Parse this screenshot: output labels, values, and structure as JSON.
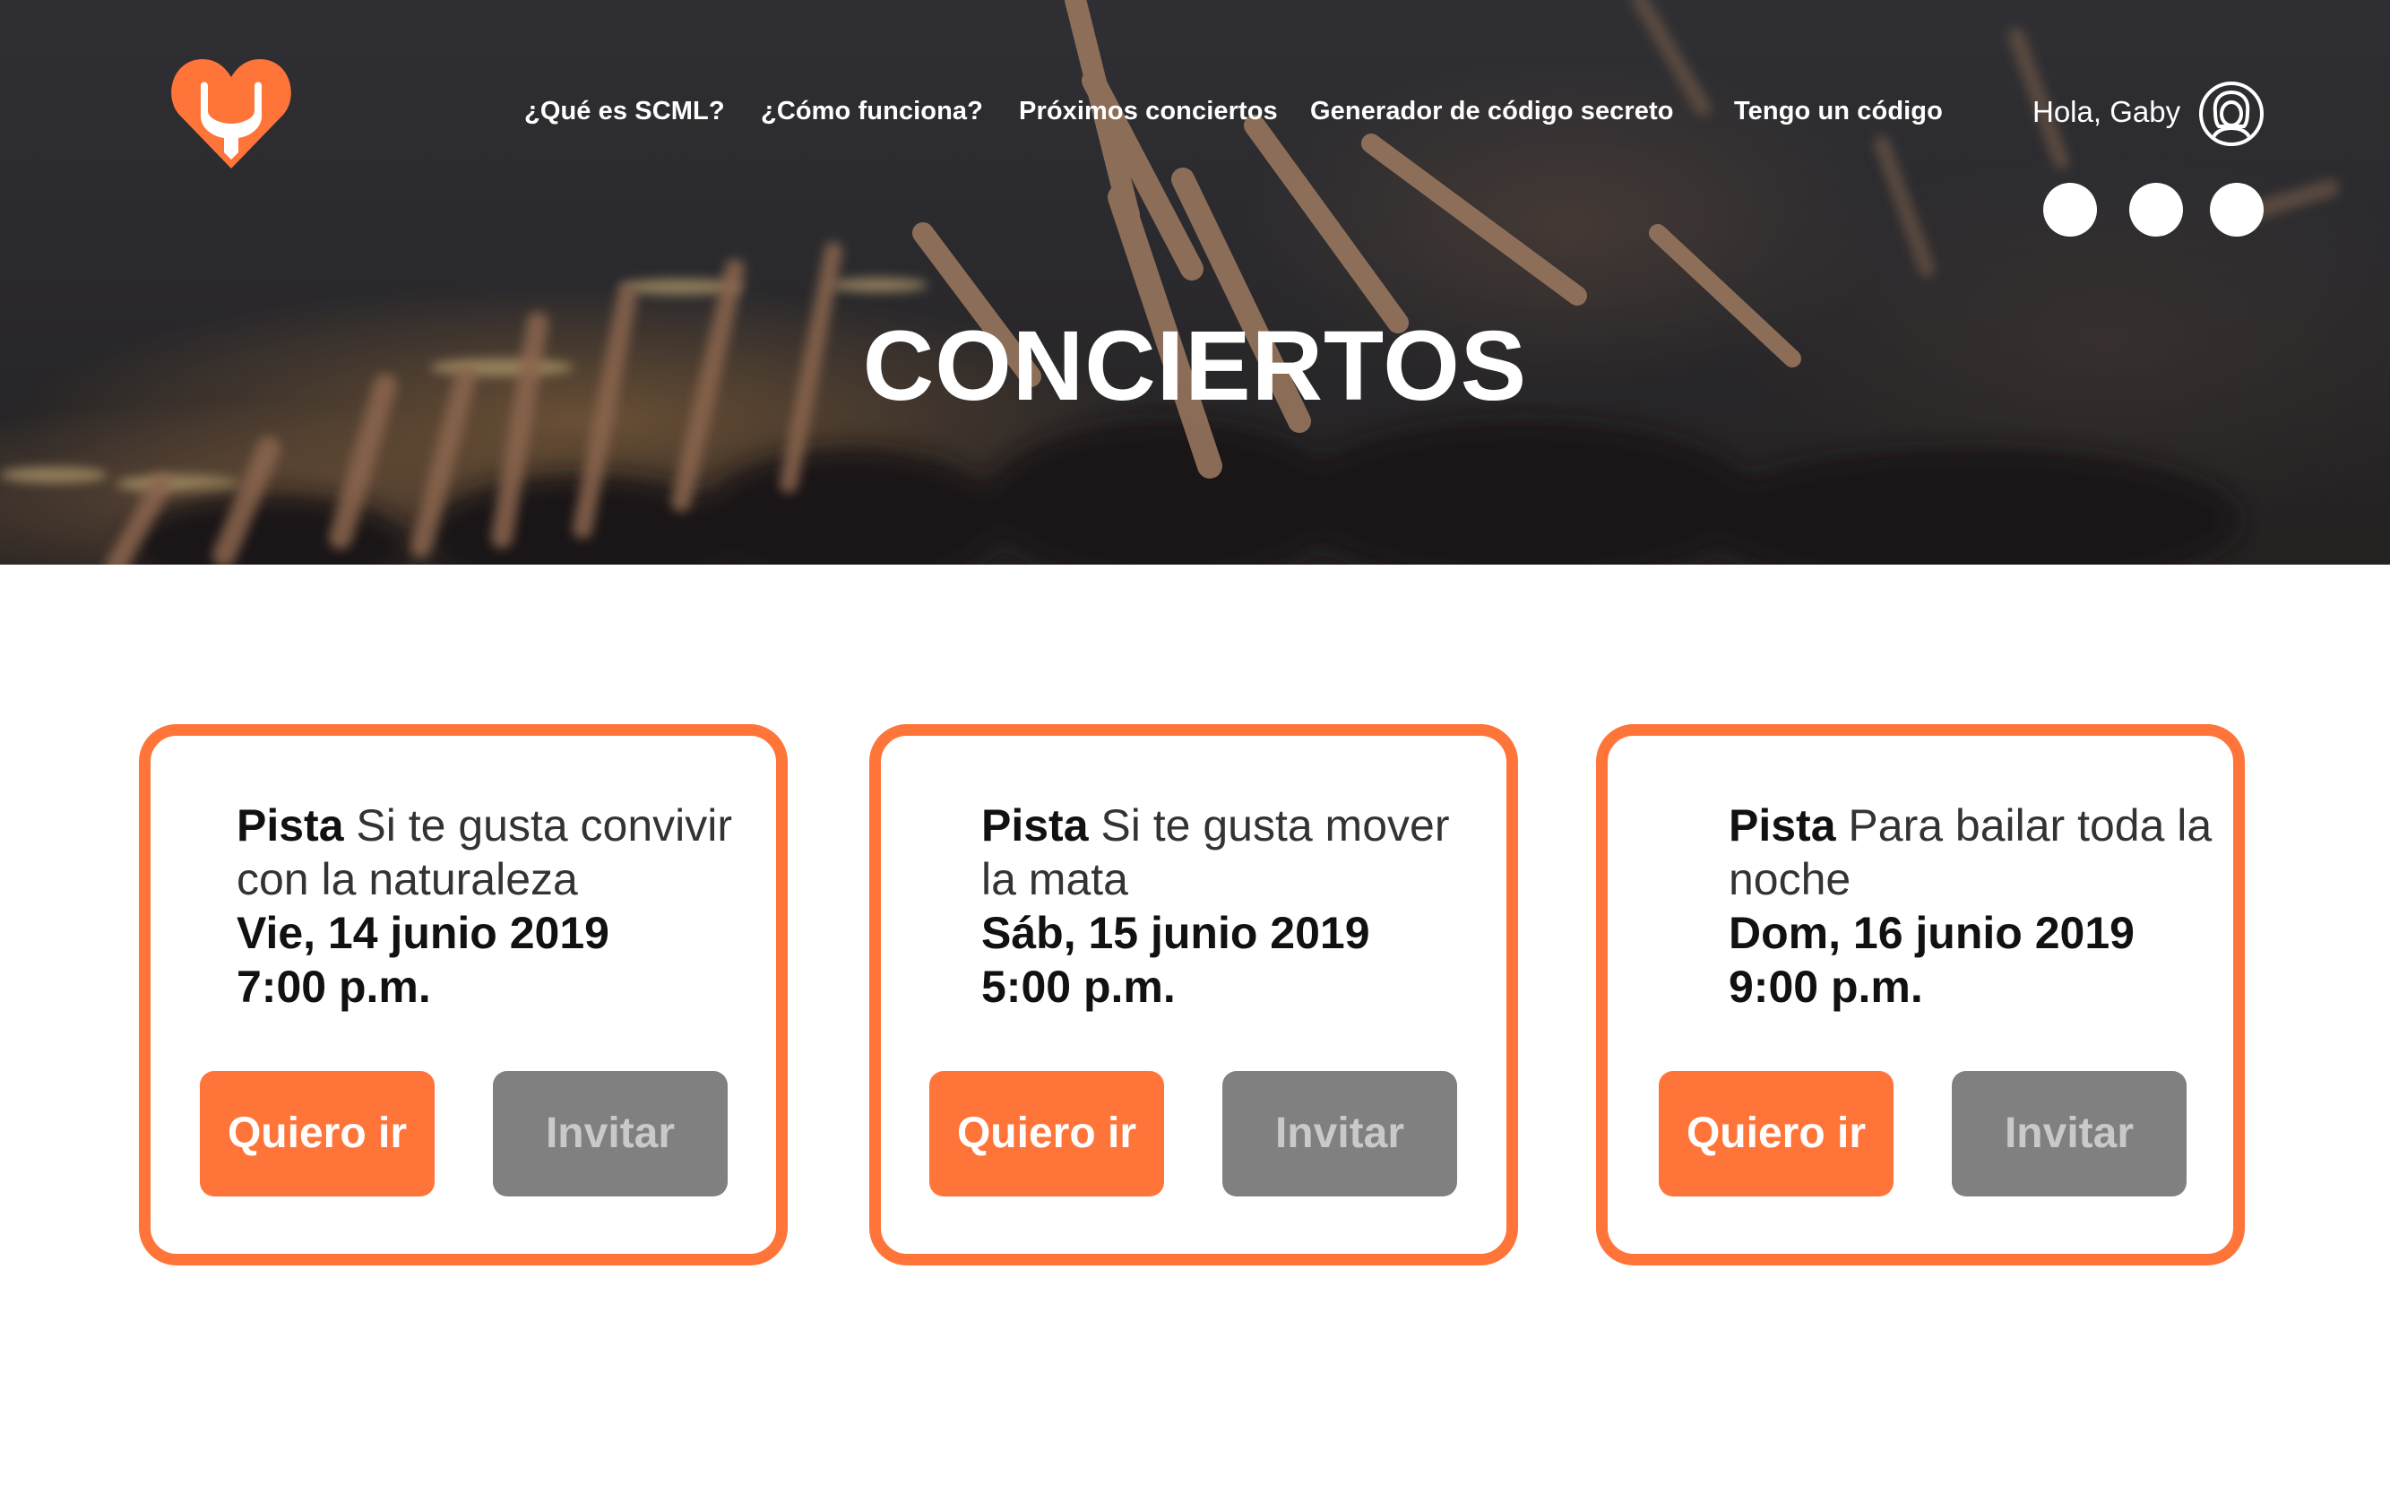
{
  "header": {
    "nav": [
      {
        "label": "¿Qué es SCML?"
      },
      {
        "label": "¿Cómo funciona?"
      },
      {
        "label": "Próximos conciertos"
      },
      {
        "label": "Generador de código secreto"
      },
      {
        "label": "Tengo un código"
      }
    ],
    "greeting": "Hola, Gaby",
    "logo_icon": "heart-logo-icon",
    "avatar_icon": "user-avatar-icon"
  },
  "hero": {
    "title": "CONCIERTOS"
  },
  "cards": [
    {
      "label": "Pista",
      "description": "Si te gusta convivir con la naturaleza",
      "date": "Vie, 14 junio 2019",
      "time": "7:00 p.m.",
      "primary_button": "Quiero ir",
      "secondary_button": "Invitar"
    },
    {
      "label": "Pista",
      "description": "Si te gusta mover la mata",
      "date": "Sáb, 15 junio 2019",
      "time": "5:00 p.m.",
      "primary_button": "Quiero ir",
      "secondary_button": "Invitar"
    },
    {
      "label": "Pista",
      "description": "Para bailar toda la noche",
      "date": "Dom, 16 junio 2019",
      "time": "9:00 p.m.",
      "primary_button": "Quiero ir",
      "secondary_button": "Invitar"
    }
  ],
  "colors": {
    "accent": "#ff7539",
    "secondary_button": "#808080",
    "hero_dark": "#333236"
  }
}
